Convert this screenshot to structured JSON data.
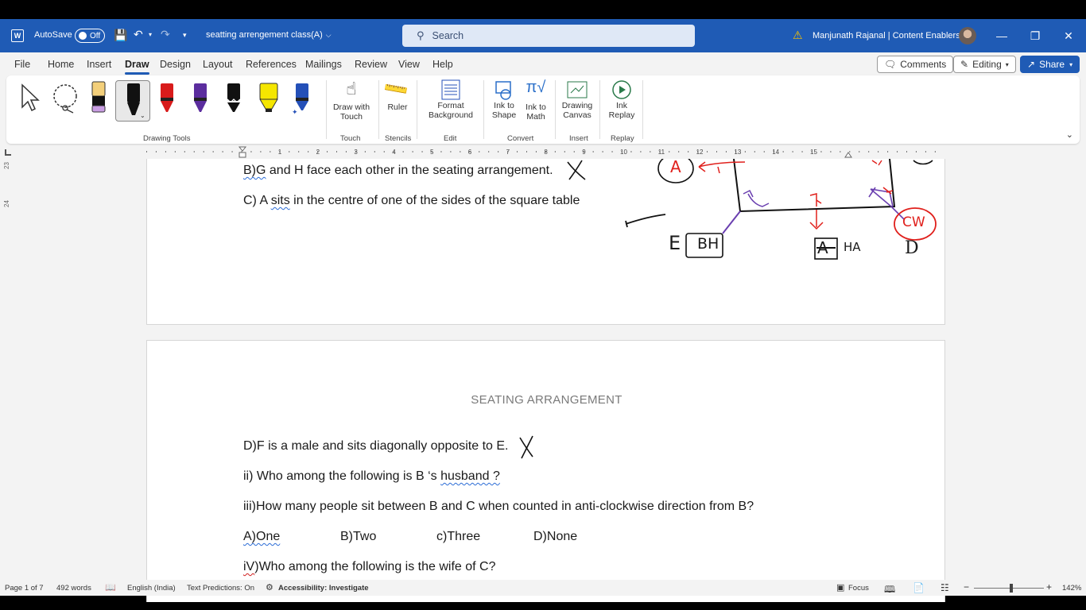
{
  "titlebar": {
    "app_icon": "word-icon",
    "autosave_label": "AutoSave",
    "autosave_state": "Off",
    "document_title": "seatting arrengement class(A)",
    "search_placeholder": "Search",
    "user_name": "Manjunath Rajanal | Content Enablers"
  },
  "menu": {
    "tabs": [
      "File",
      "Home",
      "Insert",
      "Draw",
      "Design",
      "Layout",
      "References",
      "Mailings",
      "Review",
      "View",
      "Help"
    ],
    "active_tab": "Draw",
    "comments_label": "Comments",
    "editing_label": "Editing",
    "share_label": "Share"
  },
  "ribbon": {
    "drawing_tools_label": "Drawing Tools",
    "pen_colors": [
      "#e8c566",
      "#111111",
      "#d81b1b",
      "#5b2d9e",
      "#111111",
      "#f5e600",
      "#2450b8"
    ],
    "draw_with_touch": "Draw with Touch",
    "touch_group": "Touch",
    "ruler": "Ruler",
    "stencils_group": "Stencils",
    "format_background": "Format Background",
    "edit_group": "Edit",
    "ink_to_shape": "Ink to Shape",
    "ink_to_math": "Ink to Math",
    "convert_group": "Convert",
    "drawing_canvas": "Drawing Canvas",
    "insert_group": "Insert",
    "ink_replay": "Ink Replay",
    "replay_group": "Replay"
  },
  "ruler": {
    "numbers": [
      "1",
      "2",
      "3",
      "4",
      "5",
      "6",
      "7",
      "8",
      "9",
      "10",
      "11",
      "12",
      "13",
      "14",
      "15"
    ],
    "vertical_numbers": [
      "23",
      "24"
    ]
  },
  "page1": {
    "line_b_prefix": "B)G",
    "line_b_rest": " and H face each other in the seating arrangement.",
    "line_c_prefix": "C) A ",
    "line_c_word": "sits",
    "line_c_rest": " in the centre of one of the sides of the square table",
    "diagram_labels": {
      "a_circle": "A",
      "e": "E",
      "bh": "BH",
      "a_box": "A",
      "ha": "HA",
      "d": "D",
      "cw": "CW"
    }
  },
  "page2": {
    "heading": "SEATING ARRANGEMENT",
    "line_d": "D)F is a male and sits diagonally opposite to E.",
    "line_ii_prefix": "ii) Who among the following is B ‘s ",
    "line_ii_word": "husband ?",
    "line_iii": "iii)How many people sit between B and C when counted in anti-clockwise direction from B?",
    "options": [
      "A)One",
      "B)Two",
      "c)Three",
      "D)None"
    ],
    "line_iv_prefix": "iV",
    "line_iv_rest": ")Who among the following is the wife of C?"
  },
  "statusbar": {
    "page": "Page 1 of 7",
    "words": "492 words",
    "language": "English (India)",
    "text_predictions": "Text Predictions: On",
    "accessibility": "Accessibility: Investigate",
    "focus": "Focus",
    "zoom": "142%"
  },
  "colors": {
    "brand": "#1f5bb5",
    "ink_red": "#e0201c",
    "ink_purple": "#6a3fb0",
    "ink_black": "#111111"
  }
}
